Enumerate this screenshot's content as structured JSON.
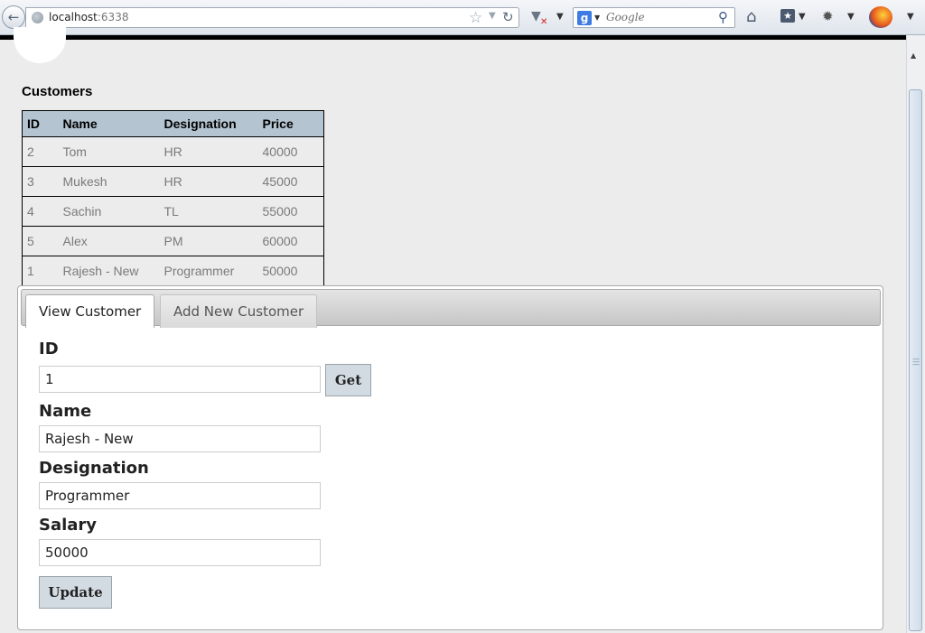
{
  "browser": {
    "url_host": "localhost",
    "url_port": ":6338",
    "search_placeholder": "Google"
  },
  "page": {
    "heading": "Customers"
  },
  "table": {
    "headers": [
      "ID",
      "Name",
      "Designation",
      "Price"
    ],
    "rows": [
      [
        "2",
        "Tom",
        "HR",
        "40000"
      ],
      [
        "3",
        "Mukesh",
        "HR",
        "45000"
      ],
      [
        "4",
        "Sachin",
        "TL",
        "55000"
      ],
      [
        "5",
        "Alex",
        "PM",
        "60000"
      ],
      [
        "1",
        "Rajesh - New",
        "Programmer",
        "50000"
      ]
    ]
  },
  "tabs": [
    {
      "label": "View Customer",
      "active": true
    },
    {
      "label": "Add New Customer",
      "active": false
    }
  ],
  "form": {
    "id_label": "ID",
    "id_value": "1",
    "get_button": "Get",
    "name_label": "Name",
    "name_value": "Rajesh - New",
    "designation_label": "Designation",
    "designation_value": "Programmer",
    "salary_label": "Salary",
    "salary_value": "50000",
    "update_button": "Update"
  }
}
